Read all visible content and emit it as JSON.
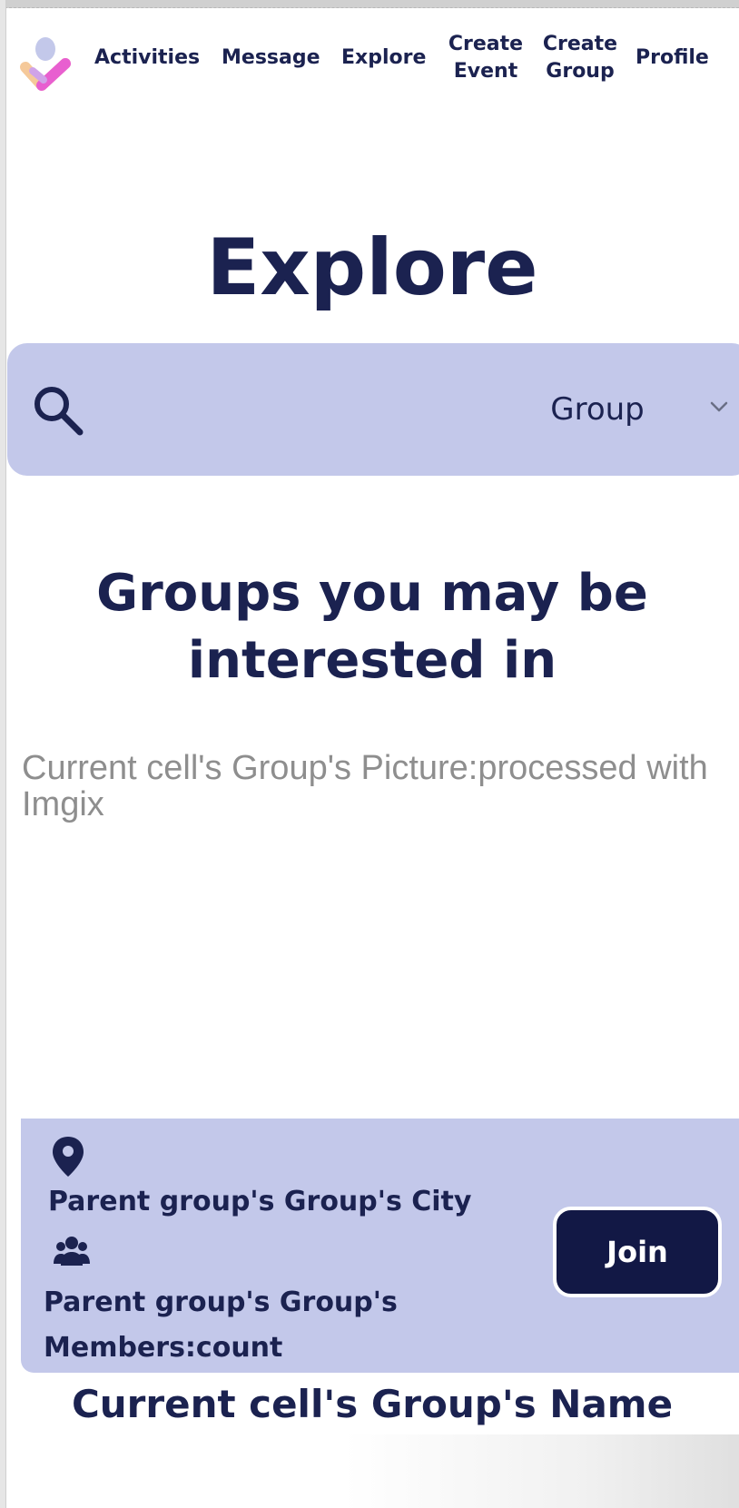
{
  "nav": {
    "items": [
      {
        "label": "Activities"
      },
      {
        "label": "Message"
      },
      {
        "label": "Explore"
      },
      {
        "line1": "Create",
        "line2": "Event"
      },
      {
        "line1": "Create",
        "line2": "Group"
      },
      {
        "label": "Profile"
      }
    ]
  },
  "page": {
    "title": "Explore"
  },
  "search": {
    "select_value": "Group"
  },
  "section": {
    "heading_line1": "Groups you may be",
    "heading_line2": "interested in"
  },
  "card": {
    "image_placeholder": "Current cell's Group's Picture:processed with Imgix",
    "city": "Parent group's Group's City",
    "members_line1": "Parent group's Group's",
    "members_line2": "Members:count",
    "join_label": "Join",
    "group_name": "Current cell's Group's Name"
  },
  "colors": {
    "navy": "#1b2250",
    "button_navy": "#121845",
    "panel_lavender": "#c3c8ea",
    "placeholder_gray": "#8e8e8e"
  },
  "icons": {
    "logo": "app-logo",
    "search": "search-icon",
    "chevron": "chevron-down-icon",
    "pin": "map-pin-icon",
    "members": "users-icon"
  }
}
